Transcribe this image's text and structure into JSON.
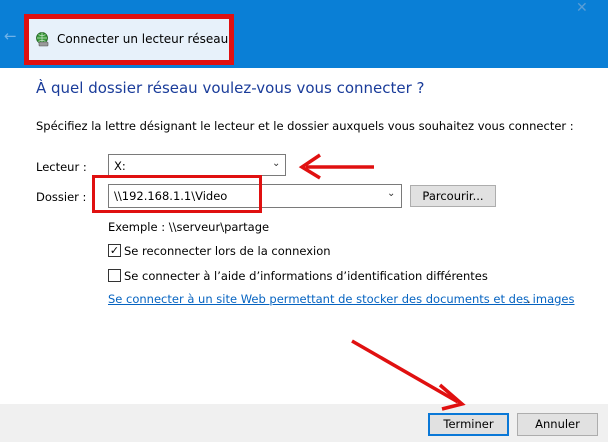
{
  "window": {
    "title": "Connecter un lecteur réseau",
    "back_icon": "back-arrow-icon",
    "close_icon": "close-icon"
  },
  "heading": "À quel dossier réseau voulez-vous vous connecter ?",
  "intro": "Spécifiez la lettre désignant le lecteur et le dossier auxquels vous souhaitez vous connecter :",
  "lecteur": {
    "label": "Lecteur :",
    "value": "X:"
  },
  "dossier": {
    "label": "Dossier :",
    "value": "\\\\192.168.1.1\\Video",
    "browse_label": "Parcourir..."
  },
  "example": "Exemple : \\\\serveur\\partage",
  "options": [
    {
      "label": "Se reconnecter lors de la connexion",
      "checked": true
    },
    {
      "label": "Se connecter à l’aide d’informations d’identification différentes",
      "checked": false
    }
  ],
  "link": "Se connecter à un site Web permettant de stocker des documents et des images",
  "link_suffix": ".",
  "buttons": {
    "finish": "Terminer",
    "cancel": "Annuler"
  },
  "colors": {
    "titlebar": "#0a7fd6",
    "annotation": "#e01010",
    "heading": "#1a3c9a",
    "link": "#0563c1"
  }
}
